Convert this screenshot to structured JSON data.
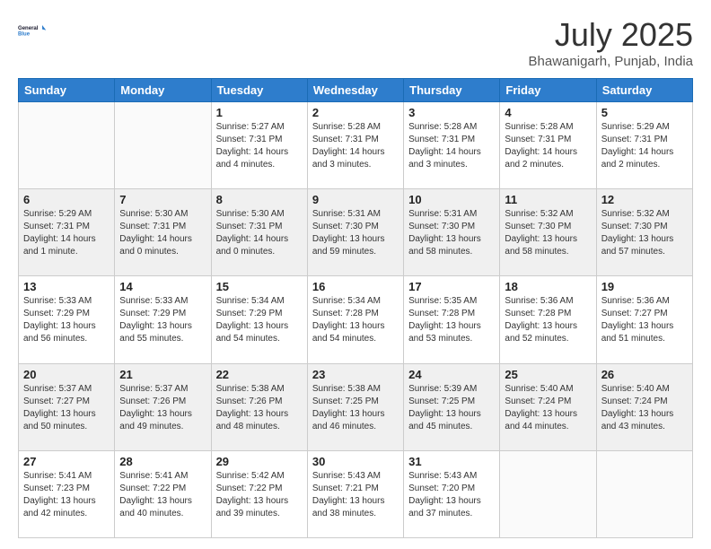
{
  "header": {
    "logo_line1": "General",
    "logo_line2": "Blue",
    "month": "July 2025",
    "location": "Bhawanigarh, Punjab, India"
  },
  "weekdays": [
    "Sunday",
    "Monday",
    "Tuesday",
    "Wednesday",
    "Thursday",
    "Friday",
    "Saturday"
  ],
  "weeks": [
    [
      {
        "day": "",
        "info": ""
      },
      {
        "day": "",
        "info": ""
      },
      {
        "day": "1",
        "info": "Sunrise: 5:27 AM\nSunset: 7:31 PM\nDaylight: 14 hours\nand 4 minutes."
      },
      {
        "day": "2",
        "info": "Sunrise: 5:28 AM\nSunset: 7:31 PM\nDaylight: 14 hours\nand 3 minutes."
      },
      {
        "day": "3",
        "info": "Sunrise: 5:28 AM\nSunset: 7:31 PM\nDaylight: 14 hours\nand 3 minutes."
      },
      {
        "day": "4",
        "info": "Sunrise: 5:28 AM\nSunset: 7:31 PM\nDaylight: 14 hours\nand 2 minutes."
      },
      {
        "day": "5",
        "info": "Sunrise: 5:29 AM\nSunset: 7:31 PM\nDaylight: 14 hours\nand 2 minutes."
      }
    ],
    [
      {
        "day": "6",
        "info": "Sunrise: 5:29 AM\nSunset: 7:31 PM\nDaylight: 14 hours\nand 1 minute."
      },
      {
        "day": "7",
        "info": "Sunrise: 5:30 AM\nSunset: 7:31 PM\nDaylight: 14 hours\nand 0 minutes."
      },
      {
        "day": "8",
        "info": "Sunrise: 5:30 AM\nSunset: 7:31 PM\nDaylight: 14 hours\nand 0 minutes."
      },
      {
        "day": "9",
        "info": "Sunrise: 5:31 AM\nSunset: 7:30 PM\nDaylight: 13 hours\nand 59 minutes."
      },
      {
        "day": "10",
        "info": "Sunrise: 5:31 AM\nSunset: 7:30 PM\nDaylight: 13 hours\nand 58 minutes."
      },
      {
        "day": "11",
        "info": "Sunrise: 5:32 AM\nSunset: 7:30 PM\nDaylight: 13 hours\nand 58 minutes."
      },
      {
        "day": "12",
        "info": "Sunrise: 5:32 AM\nSunset: 7:30 PM\nDaylight: 13 hours\nand 57 minutes."
      }
    ],
    [
      {
        "day": "13",
        "info": "Sunrise: 5:33 AM\nSunset: 7:29 PM\nDaylight: 13 hours\nand 56 minutes."
      },
      {
        "day": "14",
        "info": "Sunrise: 5:33 AM\nSunset: 7:29 PM\nDaylight: 13 hours\nand 55 minutes."
      },
      {
        "day": "15",
        "info": "Sunrise: 5:34 AM\nSunset: 7:29 PM\nDaylight: 13 hours\nand 54 minutes."
      },
      {
        "day": "16",
        "info": "Sunrise: 5:34 AM\nSunset: 7:28 PM\nDaylight: 13 hours\nand 54 minutes."
      },
      {
        "day": "17",
        "info": "Sunrise: 5:35 AM\nSunset: 7:28 PM\nDaylight: 13 hours\nand 53 minutes."
      },
      {
        "day": "18",
        "info": "Sunrise: 5:36 AM\nSunset: 7:28 PM\nDaylight: 13 hours\nand 52 minutes."
      },
      {
        "day": "19",
        "info": "Sunrise: 5:36 AM\nSunset: 7:27 PM\nDaylight: 13 hours\nand 51 minutes."
      }
    ],
    [
      {
        "day": "20",
        "info": "Sunrise: 5:37 AM\nSunset: 7:27 PM\nDaylight: 13 hours\nand 50 minutes."
      },
      {
        "day": "21",
        "info": "Sunrise: 5:37 AM\nSunset: 7:26 PM\nDaylight: 13 hours\nand 49 minutes."
      },
      {
        "day": "22",
        "info": "Sunrise: 5:38 AM\nSunset: 7:26 PM\nDaylight: 13 hours\nand 48 minutes."
      },
      {
        "day": "23",
        "info": "Sunrise: 5:38 AM\nSunset: 7:25 PM\nDaylight: 13 hours\nand 46 minutes."
      },
      {
        "day": "24",
        "info": "Sunrise: 5:39 AM\nSunset: 7:25 PM\nDaylight: 13 hours\nand 45 minutes."
      },
      {
        "day": "25",
        "info": "Sunrise: 5:40 AM\nSunset: 7:24 PM\nDaylight: 13 hours\nand 44 minutes."
      },
      {
        "day": "26",
        "info": "Sunrise: 5:40 AM\nSunset: 7:24 PM\nDaylight: 13 hours\nand 43 minutes."
      }
    ],
    [
      {
        "day": "27",
        "info": "Sunrise: 5:41 AM\nSunset: 7:23 PM\nDaylight: 13 hours\nand 42 minutes."
      },
      {
        "day": "28",
        "info": "Sunrise: 5:41 AM\nSunset: 7:22 PM\nDaylight: 13 hours\nand 40 minutes."
      },
      {
        "day": "29",
        "info": "Sunrise: 5:42 AM\nSunset: 7:22 PM\nDaylight: 13 hours\nand 39 minutes."
      },
      {
        "day": "30",
        "info": "Sunrise: 5:43 AM\nSunset: 7:21 PM\nDaylight: 13 hours\nand 38 minutes."
      },
      {
        "day": "31",
        "info": "Sunrise: 5:43 AM\nSunset: 7:20 PM\nDaylight: 13 hours\nand 37 minutes."
      },
      {
        "day": "",
        "info": ""
      },
      {
        "day": "",
        "info": ""
      }
    ]
  ]
}
